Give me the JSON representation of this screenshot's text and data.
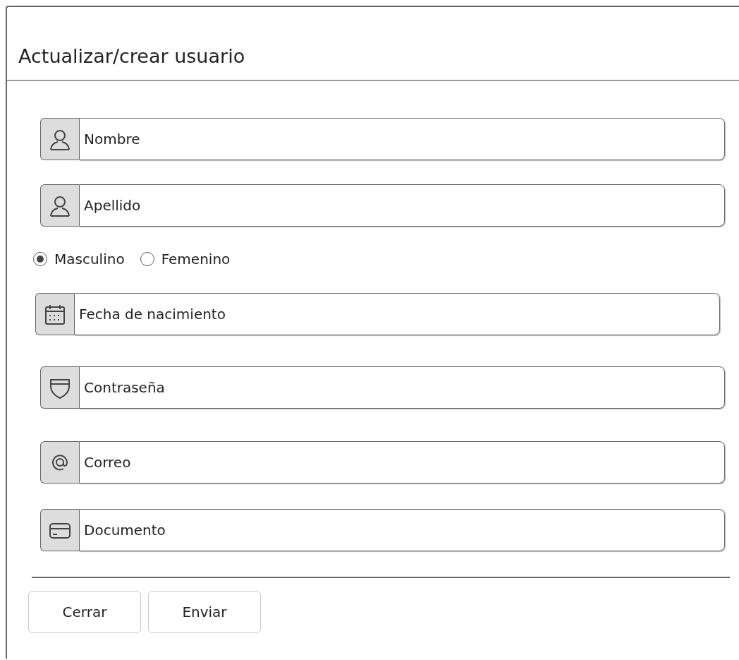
{
  "dialog": {
    "title": "Actualizar/crear usuario"
  },
  "fields": [
    {
      "kind": "person",
      "placeholder": "Nombre"
    },
    {
      "kind": "person",
      "placeholder": "Apellido"
    },
    {
      "kind": "gender",
      "options": [
        {
          "label": "Masculino",
          "selected": true
        },
        {
          "label": "Femenino",
          "selected": false
        }
      ]
    },
    {
      "kind": "calendar",
      "placeholder": "Fecha de nacimiento"
    },
    {
      "kind": "shield",
      "placeholder": "Contraseña"
    },
    {
      "kind": "at",
      "placeholder": "Correo"
    },
    {
      "kind": "card",
      "placeholder": "Documento"
    }
  ],
  "buttons": [
    "Cerrar",
    "Enviar"
  ]
}
